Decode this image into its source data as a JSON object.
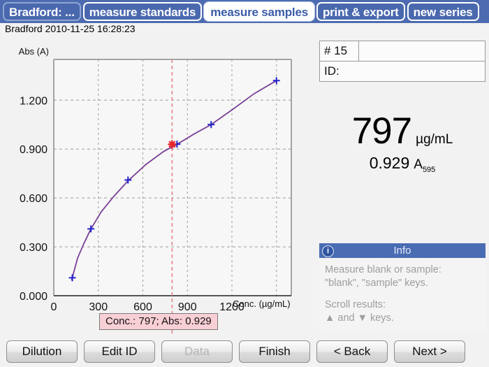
{
  "tabs": [
    {
      "label": "Bradford:  ...",
      "active": false
    },
    {
      "label": "measure standards",
      "active": false
    },
    {
      "label": "measure samples",
      "active": true
    },
    {
      "label": "print & export",
      "active": false
    },
    {
      "label": "new series",
      "active": false
    }
  ],
  "header": {
    "subtitle": "Bradford 2010-11-25 16:28:23"
  },
  "sample": {
    "number_label": "# 15",
    "number_value": "",
    "id_label": "ID:",
    "id_value": "",
    "conc_value": "797",
    "conc_unit": "µg/mL",
    "abs_value": "0.929",
    "abs_symbol": "A",
    "abs_subscript": "595"
  },
  "annotation": {
    "text": "Conc.: 797; Abs: 0.929"
  },
  "info": {
    "icon": "info-circle-icon",
    "title": "Info",
    "line1": "Measure blank or sample:",
    "line2": "\"blank\", \"sample\" keys.",
    "line3": "Scroll results:",
    "line4": "▲ and ▼ keys."
  },
  "buttons": [
    {
      "label": "Dilution",
      "disabled": false
    },
    {
      "label": "Edit ID",
      "disabled": false
    },
    {
      "label": "Data",
      "disabled": true
    },
    {
      "label": "Finish",
      "disabled": false
    },
    {
      "label": "< Back",
      "disabled": false
    },
    {
      "label": "Next >",
      "disabled": false
    }
  ],
  "colors": {
    "tab_blue": "#4a68ae",
    "curve_purple": "#7b3f98",
    "standard_marker": "#2222cc",
    "sample_marker": "#e8262a",
    "annotation_bg": "#f9cfd6",
    "info_header": "#4a6cb3"
  },
  "chart_data": {
    "type": "line",
    "title": "",
    "xlabel": "Conc. (µg/mL)",
    "ylabel": "Abs (A)",
    "xlim": [
      0,
      1600
    ],
    "ylim": [
      0.0,
      1.45
    ],
    "xticks": [
      0,
      300,
      600,
      900,
      1200,
      1500
    ],
    "xticklabels": [
      "0",
      "300",
      "600",
      "900",
      "1200",
      ""
    ],
    "yticks": [
      0.0,
      0.3,
      0.6,
      0.9,
      1.2
    ],
    "yticklabels": [
      "0.000",
      "0.300",
      "0.600",
      "0.900",
      "1.200"
    ],
    "grid": true,
    "legend": "none",
    "series": [
      {
        "name": "standards",
        "type": "scatter",
        "marker": "plus",
        "color": "#2222cc",
        "x": [
          125,
          250,
          500,
          830,
          1060,
          1500
        ],
        "y": [
          0.11,
          0.41,
          0.71,
          0.93,
          1.05,
          1.32
        ]
      },
      {
        "name": "fit curve",
        "type": "line",
        "color": "#7b3f98",
        "x": [
          120,
          160,
          200,
          250,
          320,
          400,
          500,
          620,
          740,
          830,
          950,
          1060,
          1200,
          1350,
          1500
        ],
        "y": [
          0.095,
          0.23,
          0.315,
          0.41,
          0.515,
          0.605,
          0.705,
          0.805,
          0.885,
          0.929,
          0.995,
          1.05,
          1.14,
          1.24,
          1.32
        ]
      },
      {
        "name": "sample",
        "type": "scatter",
        "marker": "star",
        "color": "#e8262a",
        "x": [
          797
        ],
        "y": [
          0.929
        ]
      }
    ],
    "annotations": [
      {
        "type": "vline",
        "x": 797,
        "color": "#e8828a",
        "style": "dashed",
        "label": "Conc.: 797; Abs: 0.929"
      }
    ]
  }
}
